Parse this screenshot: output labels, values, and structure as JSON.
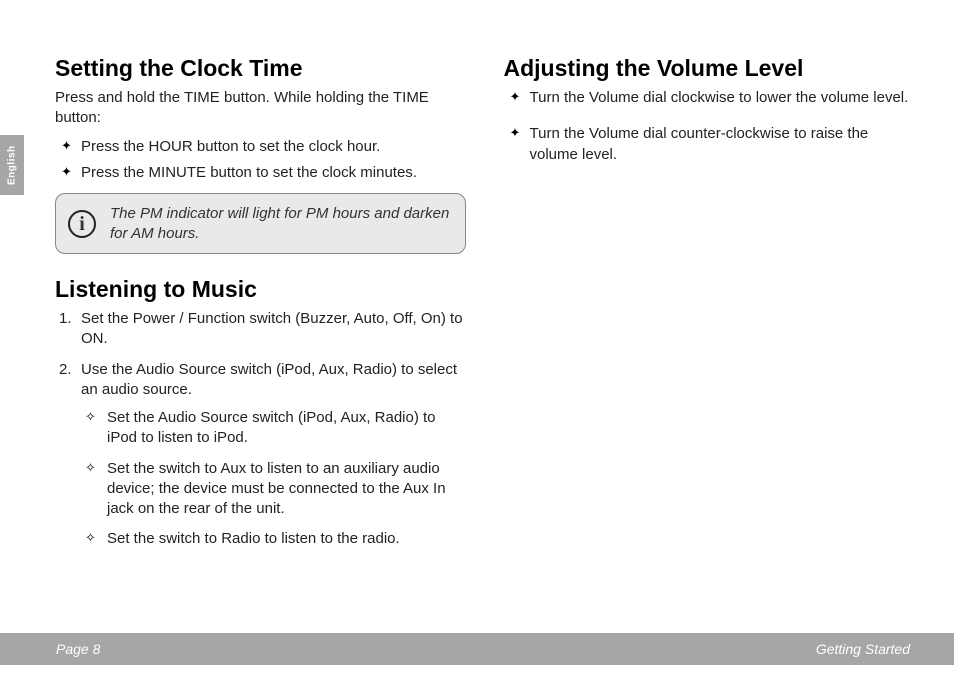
{
  "sideTab": "English",
  "left": {
    "h1": "Setting the Clock Time",
    "intro": "Press and hold the TIME button. While holding the TIME button:",
    "bullets": [
      "Press the HOUR button to set the clock hour.",
      "Press the MINUTE button to set the clock minutes."
    ],
    "note": "The PM indicator will light for PM hours and darken for AM hours.",
    "h2": "Listening to Music",
    "steps": [
      "Set the Power / Function switch (Buzzer, Auto, Off, On) to ON.",
      "Use the Audio Source switch (iPod, Aux, Radio) to select an audio source."
    ],
    "subs": [
      "Set the Audio Source switch (iPod, Aux, Radio) to iPod to listen to iPod.",
      "Set the switch to Aux to listen to an auxiliary audio device; the device must be connected to the Aux In jack on the rear of the unit.",
      "Set the switch to Radio to listen to the radio."
    ]
  },
  "right": {
    "h1": "Adjusting the Volume Level",
    "bullets": [
      "Turn the Volume dial clockwise to lower the volume level.",
      "Turn the Volume dial counter-clockwise to raise the volume level."
    ]
  },
  "footer": {
    "left": "Page 8",
    "right": "Getting Started"
  }
}
